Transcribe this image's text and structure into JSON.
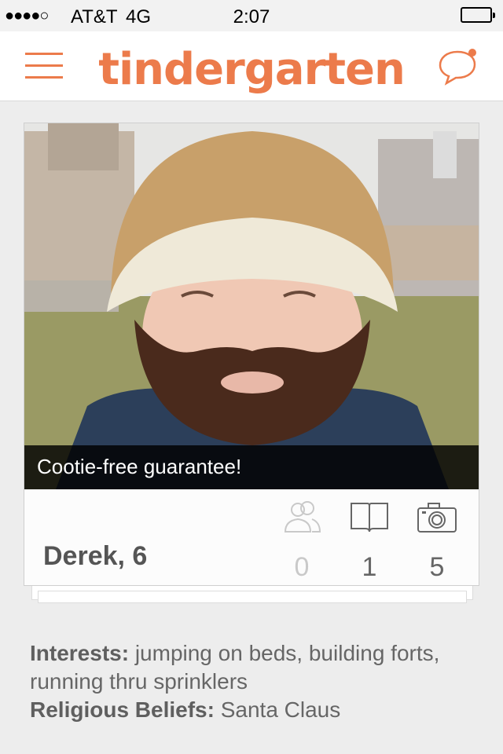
{
  "status_bar": {
    "signal": "●●●●○",
    "carrier": "AT&T",
    "network": "4G",
    "time": "2:07"
  },
  "nav": {
    "logo": "tindergarten",
    "accent_color": "#ec7b4b"
  },
  "card": {
    "caption": "Cootie-free guarantee!",
    "name_age": "Derek, 6",
    "stats": [
      {
        "icon": "friends-icon",
        "value": "0"
      },
      {
        "icon": "book-icon",
        "value": "1"
      },
      {
        "icon": "camera-icon",
        "value": "5"
      }
    ]
  },
  "details": {
    "interests_label": "Interests:",
    "interests_value": "jumping on beds, building forts, running thru sprinklers",
    "beliefs_label": "Religious Beliefs:",
    "beliefs_value": "Santa Claus"
  }
}
